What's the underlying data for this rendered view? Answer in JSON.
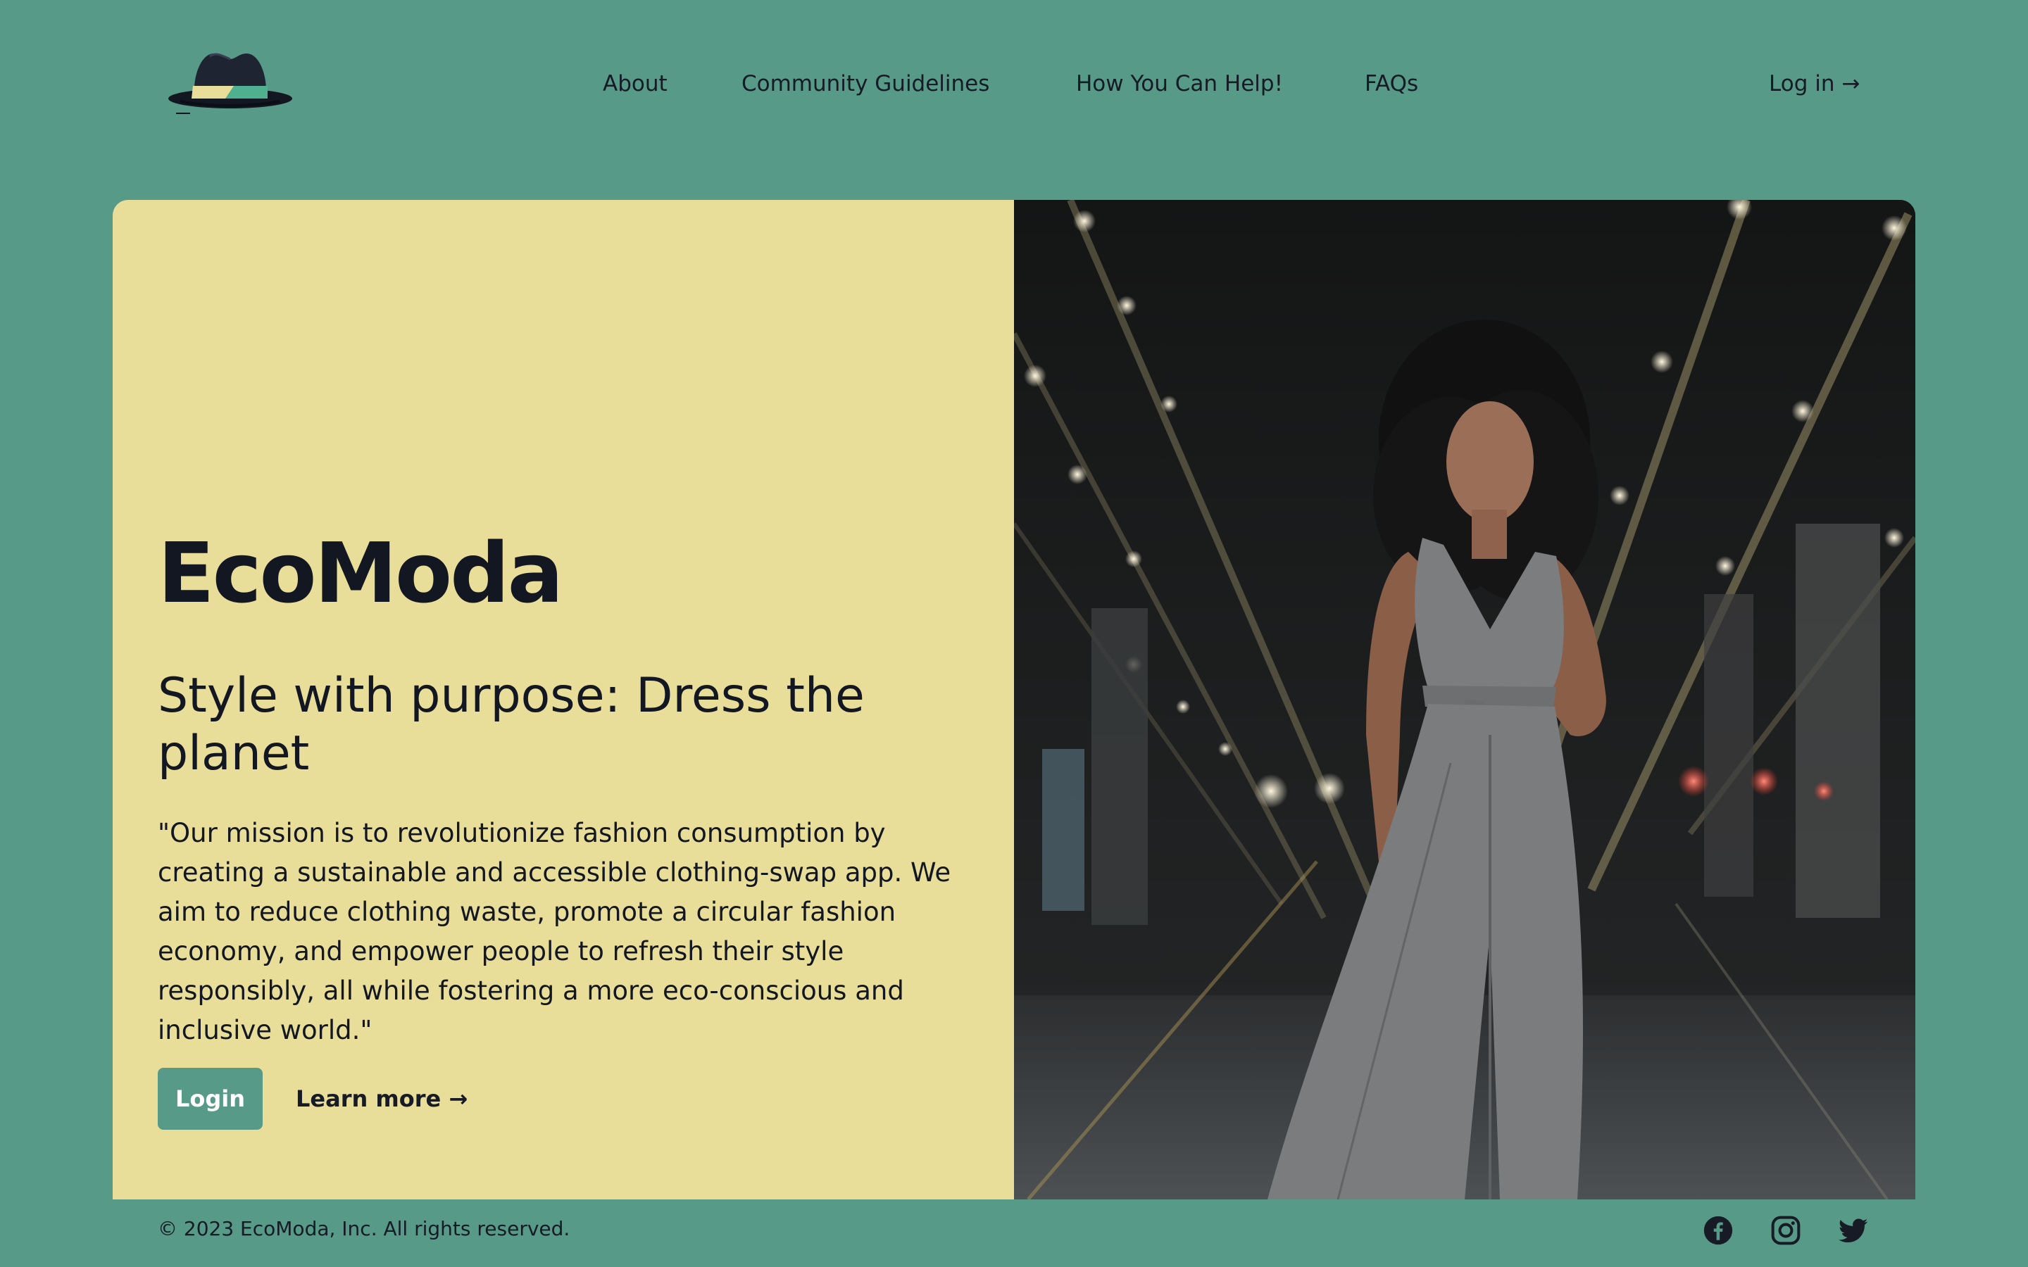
{
  "header": {
    "logo_icon": "fedora-hat-icon",
    "nav": [
      {
        "label": "About"
      },
      {
        "label": "Community Guidelines"
      },
      {
        "label": "How You Can Help!"
      },
      {
        "label": "FAQs"
      }
    ],
    "login_label": "Log in →"
  },
  "hero": {
    "title": "EcoModa",
    "subtitle": "Style with purpose: Dress the planet",
    "mission": "\"Our mission is to revolutionize fashion consumption by creating a sustainable and accessible clothing-swap app. We aim to reduce clothing waste, promote a circular fashion economy, and empower people to refresh their style responsibly, all while fostering a more eco-conscious and inclusive world.\"",
    "login_button": "Login",
    "learn_more": "Learn more →",
    "image_icon": "woman-in-jumpsuit-photo"
  },
  "footer": {
    "copyright": "© 2023 EcoModa, Inc. All rights reserved.",
    "social": [
      {
        "icon": "facebook-icon"
      },
      {
        "icon": "instagram-icon"
      },
      {
        "icon": "twitter-icon"
      }
    ]
  },
  "colors": {
    "background": "#579a87",
    "hero_panel": "#e8dd99",
    "text": "#161b26",
    "button": "#579a87",
    "button_text": "#ffffff"
  }
}
